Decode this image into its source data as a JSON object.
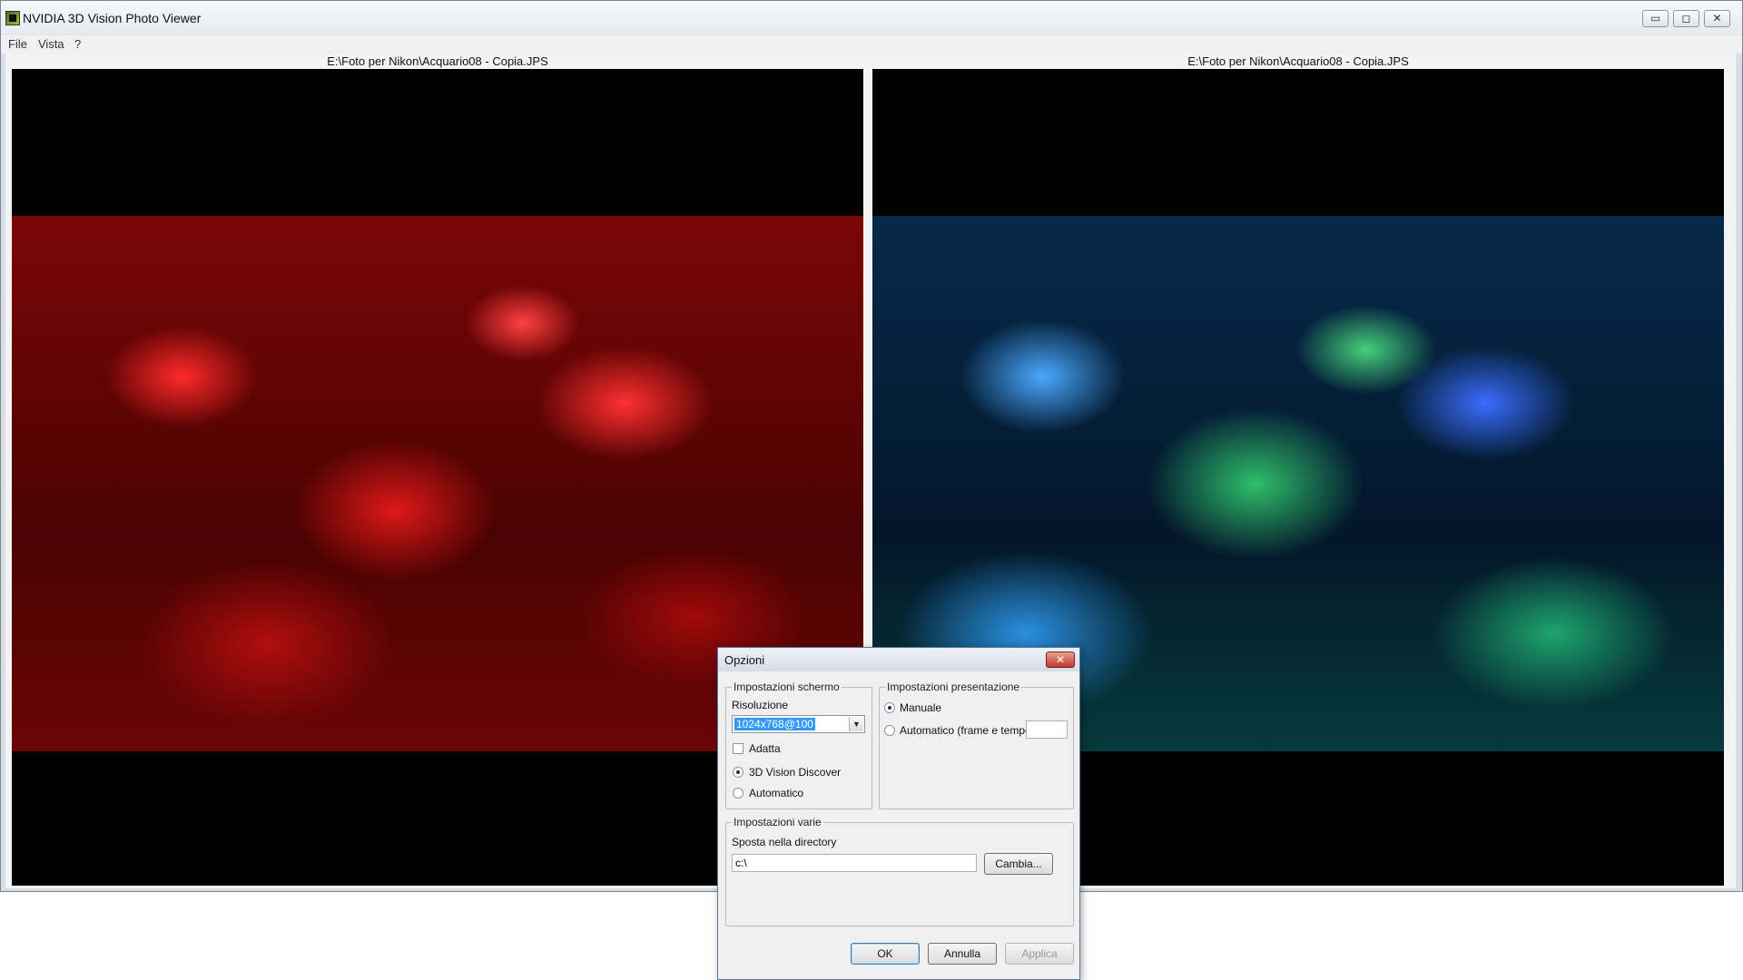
{
  "window": {
    "title": "NVIDIA 3D Vision Photo Viewer",
    "controls": {
      "minimize": "▭",
      "maximize": "◻",
      "close": "✕"
    }
  },
  "menu": [
    "File",
    "Vista",
    "?"
  ],
  "panes": {
    "left_path": "E:\\Foto per Nikon\\Acquario08 - Copia.JPS",
    "right_path": "E:\\Foto per Nikon\\Acquario08 - Copia.JPS"
  },
  "dialog": {
    "title": "Opzioni",
    "close_glyph": "✕",
    "screen_group": {
      "label": "Impostazioni schermo",
      "resolution_label": "Risoluzione",
      "resolution_value": "1024x768@100",
      "fit_label": "Adatta",
      "fit_checked": false,
      "options": [
        {
          "label": "3D Vision Discover",
          "selected": true
        },
        {
          "label": "Automatico",
          "selected": false
        }
      ]
    },
    "presentation_group": {
      "label": "Impostazioni presentazione",
      "options": [
        {
          "label": "Manuale",
          "selected": true
        },
        {
          "label": "Automatico (frame e tempo)",
          "selected": false
        }
      ],
      "time_value": ""
    },
    "misc_group": {
      "label": "Impostazioni varie",
      "move_dir_label": "Sposta nella directory",
      "dir_value": "c:\\",
      "change_button": "Cambia..."
    },
    "buttons": {
      "ok": "OK",
      "cancel": "Annulla",
      "apply": "Applica"
    }
  }
}
